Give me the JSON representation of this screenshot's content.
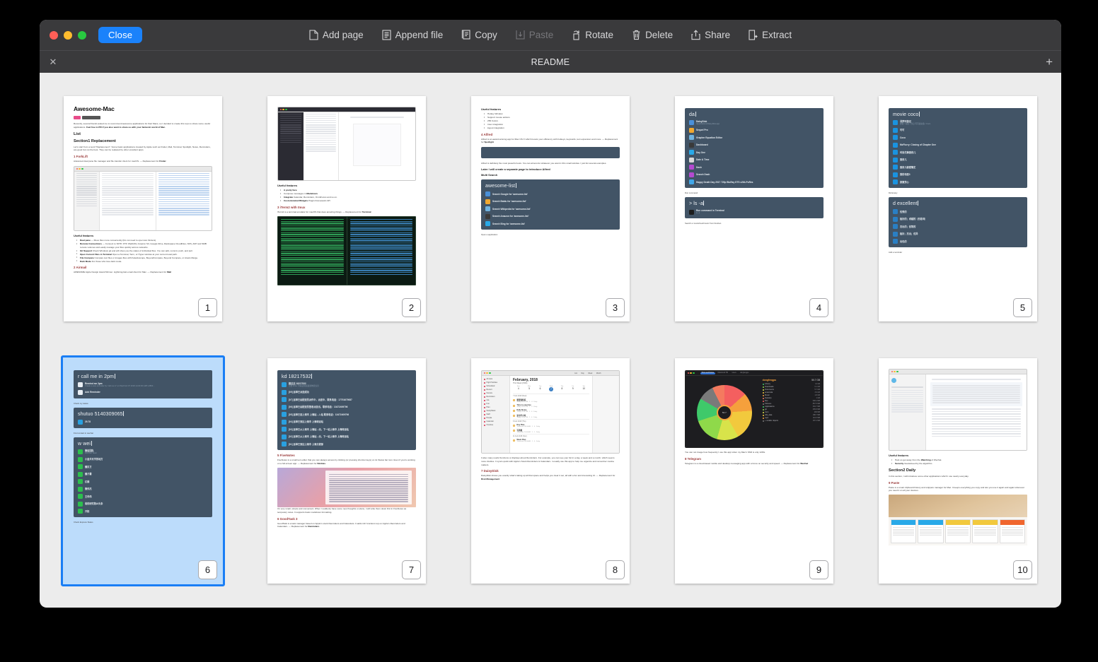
{
  "window": {
    "close_button": "Close",
    "traffic_lights": [
      "close-red",
      "minimize-yellow",
      "zoom-green"
    ]
  },
  "toolbar": {
    "items": [
      {
        "label": "Add page",
        "icon": "add-page-icon",
        "disabled": false
      },
      {
        "label": "Append file",
        "icon": "append-file-icon",
        "disabled": false
      },
      {
        "label": "Copy",
        "icon": "copy-icon",
        "disabled": false
      },
      {
        "label": "Paste",
        "icon": "paste-icon",
        "disabled": true
      },
      {
        "label": "Rotate",
        "icon": "rotate-icon",
        "disabled": false
      },
      {
        "label": "Delete",
        "icon": "delete-trash-icon",
        "disabled": false
      },
      {
        "label": "Share",
        "icon": "share-icon",
        "disabled": false
      },
      {
        "label": "Extract",
        "icon": "extract-icon",
        "disabled": false
      }
    ]
  },
  "tabbar": {
    "close_icon": "✕",
    "title": "README",
    "add_icon": "+"
  },
  "colors": {
    "accent_blue": "#1a82fb",
    "selection_border": "#1a7ef5",
    "selection_fill": "#bcdcfb",
    "toolbar_bg": "#3a3a3c",
    "canvas_bg": "#ececec",
    "alfred_panel": "#425466"
  },
  "pages": [
    {
      "number": "1",
      "selected": false,
      "title": "Awesome-Mac",
      "intro": "Recently, several friends asked me to recommend awesome applications for their Macs, so I decided to create this repo to share some useful applications. <b>Feel free to PR if you also want to share us with your fantastic world of Mac.</b>",
      "section_list": "List",
      "section": "Section1 Replacement",
      "section_desc": "Let's start from a word \"Replacement\". Some basic applications created by Apple such as Finder, Mail, Terminal, Spotlight, Notes, Reminders, are good but not the best. They can be replaced by other excellent apps.",
      "item": "1 ForkLift",
      "item_desc": "Advanced dual pane file manager and file transfer client for macOS. — Replacement for <b>Finder</b>",
      "features_label": "Useful features",
      "features": [
        "<b>Dual pane</b> — Move files more conveniently (Do not need to open two Finders)",
        "<b>Remote Connections</b> — Connect to SFTP, FTP, WebDAV, Amazon S3, Google Drive, Rackspace CloudFiles, NFS, AFP and SMB remote volumes and easily manage your files quickly across networks.",
        "<b>Git Support</b> Check Windows git and will show you the status of individual files. You can add, commit, push, and pull.",
        "<b>Open Current Files in Terminal</b> Open a Terminal, Term, or Hyper window at your current local path.",
        "<b>File Compare</b> Compare text files or images files with Kaleidoscope, BeyondCompare, Beyond Compare, or Araxis Merge.",
        "<b>Dark Mode</b> For those who love dark mode."
      ],
      "item2": "2 Airmail",
      "item2_desc": "AWESOME Apple Design Award Winner. Lightning-fast email client for Mac. — Replacement for <b>Mail</b>"
    },
    {
      "number": "2",
      "selected": false,
      "features_label": "Useful features",
      "features": [
        "<b>A pretty face</b>",
        "Compose messages in <b>Markdown</b>.",
        "<b>Integrate</b> Calendar, Reminders, OmniFocus and so on.",
        "<b>Customization/Widgets</b> Plugin Framework API"
      ],
      "item": "3 iTerm2 with tmux",
      "item_desc": "iTerm2 is a terminal emulator for macOS that does amazing things. — Replacement for <b>Terminal</b>"
    },
    {
      "number": "3",
      "selected": false,
      "features_label": "Useful features",
      "features": [
        "Hotkey Window",
        "Support mouse actions",
        "256 Colors",
        "tmux integration",
        "logout integration"
      ],
      "item": "4 Alfred",
      "item_desc": "Alfred is an award-winning app for Mac OS X which boosts your efficiency with hotkeys, keywords, text expansion and more. — Replacement for <b>Spotlight</b>",
      "note": "Alfred is definitely the most powerful tools. You can almost do whatever you want in this small window. I just list several examples.",
      "note2": "Later I will create a separate page to introduce Alfred",
      "note3": "Multi Search",
      "alfred_query": "awesome-list",
      "alfred_rows": [
        "Search Google for 'awesome-list'",
        "Search Baidu for 'awesome-list'",
        "Search Wikipedia for 'awesome-list'",
        "Search Amazon for 'awesome-list'",
        "Search Bing for 'awesome-list'"
      ],
      "footer": "Open a application"
    },
    {
      "number": "4",
      "selected": false,
      "alfred_query": "da",
      "alfred_rows": [
        {
          "t1": "DaisyDisk",
          "t2": "/Applications/DaisyDisk.app"
        },
        {
          "t1": "Sequel Pro",
          "t2": ""
        },
        {
          "t1": "Grapher Equation Editor",
          "t2": ""
        },
        {
          "t1": "Dashboard",
          "t2": ""
        },
        {
          "t1": "Day One",
          "t2": ""
        },
        {
          "t1": "Date & Time",
          "t2": ""
        },
        {
          "t1": "Dash",
          "t2": ""
        },
        {
          "t1": "Search Dash",
          "t2": ""
        },
        {
          "t1": "Happy Death Day 2017 720p BluRay DTS x264-PuRes",
          "t2": ""
        }
      ],
      "caption1": "Run command",
      "alfred_query2": "ls -a",
      "alfred_rows2": [
        {
          "t1": "Run command in Terminal",
          "t2": "ls -a"
        }
      ],
      "caption2": "Search a movie/book/music from Douban"
    },
    {
      "number": "5",
      "selected": false,
      "alfred_query": "movie coco",
      "alfred_rows": [
        {
          "t1": "寻梦环游记",
          "t2": "剧情 / 动画 / 奇幻  可可夜总会 / Coco"
        },
        {
          "t1": "可可",
          "t2": ""
        },
        {
          "t1": "Coco",
          "t2": ""
        },
        {
          "t1": "McFlurry: Closing of Chapter One",
          "t2": ""
        },
        {
          "t1": "时尚先锋香奈儿",
          "t2": ""
        },
        {
          "t1": "香奈儿",
          "t2": ""
        },
        {
          "t1": "香奈儿秘密情史",
          "t2": ""
        },
        {
          "t1": "我的邻居3",
          "t2": ""
        },
        {
          "t1": "寂寞芳心",
          "t2": ""
        }
      ],
      "caption1": "Dictionary",
      "alfred_query2": "d excellent",
      "alfred_rows2": [
        {
          "t1": "优秀的",
          "t2": ""
        },
        {
          "t1": "极好的；卓越的（形容词）",
          "t2": ""
        },
        {
          "t1": "杰出的；优等的",
          "t2": ""
        },
        {
          "t1": "极好；杰出；优异",
          "t2": ""
        },
        {
          "t1": "出色的",
          "t2": ""
        }
      ],
      "caption2": "Add a reminder"
    },
    {
      "number": "6",
      "selected": true,
      "alfred_query": "r call me in 2pm",
      "alfred_rows": [
        {
          "t1": "Remind me 2pm",
          "t2": "Create a new reminder by \"call me in\" on Wed Feb 07 2018 14:00:00 GMT+0800..."
        },
        {
          "t1": "Add Reminder",
          "t2": ""
        }
      ],
      "caption1": "Check my status",
      "alfred_query2": "shutuo 5140309065",
      "alfred_rows2": [
        {
          "t1": "29.78",
          "t2": ""
        }
      ],
      "caption2": "Find contact in wechat",
      "alfred_query3": "w wei",
      "alfred_rows3": [
        {
          "t1": "微信团队",
          "t2": "WeChat Team"
        },
        {
          "t1": "小金共写字的地方",
          "t2": ""
        },
        {
          "t1": "魏东方",
          "t2": ""
        },
        {
          "t1": "魏子豪",
          "t2": ""
        },
        {
          "t1": "红娟",
          "t2": ""
        },
        {
          "t1": "微伟杰",
          "t2": ""
        },
        {
          "t1": "王伟伟",
          "t2": ""
        },
        {
          "t1": "卷的研究院AI头条",
          "t2": ""
        },
        {
          "t1": "开阳",
          "t2": ""
        }
      ],
      "caption3": "Check Express Status"
    },
    {
      "number": "7",
      "selected": false,
      "alfred_query": "kd 18217532",
      "alfred_rows": [
        {
          "t1": "韵达达 18217532",
          "t2": "点击 Enter 查看该快递最新物流信息"
        },
        {
          "t1": "[09] 运单已派送成功",
          "t2": ""
        },
        {
          "t1": "[07] 运单已由配送员派件中，派送中，联系电话：17701670087",
          "t2": ""
        },
        {
          "t1": "[06] 运单已由配送员签收派送出，联系电话：13472409706",
          "t2": ""
        },
        {
          "t1": "[05] 运单已进上海市 上海站…入站 联系电话：13472409706",
          "t2": ""
        },
        {
          "t1": "[04] 运单已到达上海市 上海转运站",
          "t2": ""
        },
        {
          "t1": "[03] 运单已从上海市 上海站…出，下一站上海市 上海转运站",
          "t2": ""
        },
        {
          "t1": "[02] 运单已从上海市 上海站…出，下一站上海市 上海转运站",
          "t2": ""
        },
        {
          "t1": "[01] 运单已到达上海市 上海分拨部",
          "t2": ""
        }
      ],
      "item": "5 FiveNotes",
      "item_desc": "FiveNotes is a small text editor that you can always access by clicking (or pressing shortcut keys) on its Status bar icon. Even if you're working on a full-screen app. — Replacement for <b>Stickies</b>",
      "item_desc2": "It's very small, simple and convenient. When I suddenly have some new thoughts or plans, I will write them down first in FiveNotes as temporary notes. It supports basic markdown formatting.",
      "item2": "6 GoodTask 3",
      "item2_desc": "GoodTask is a task manager based on Apple's stock Reminders and Calendars. It adds rich functions top on Apple's Reminders and Calendars. — Replacement for <b>Reminders</b>"
    },
    {
      "number": "8",
      "selected": false,
      "app_title": "February, 2018",
      "app_sub": "This Week (CW6)",
      "app_days": [
        "Sun",
        "Mon",
        "Tue",
        "Wed",
        "Thu",
        "Fri",
        "Sat"
      ],
      "app_dates": [
        "4",
        "5",
        "6",
        "7",
        "8",
        "9",
        "10"
      ],
      "app_sidebar": [
        "All Lists",
        "High Priorities",
        "Scheduled",
        "Recent",
        "Snooze",
        "Reminders",
        "Life",
        "Fun",
        "Plan",
        "Study/Work",
        "Staff",
        "People",
        "Calendar",
        "Overdue"
      ],
      "app_tabs": [
        "List",
        "Day",
        "Week",
        "Month"
      ],
      "app_sections": [
        {
          "head": "7 Feb 2018 (Wed)",
          "tasks": [
            {
              "t1": "整理资料库",
              "t2": "Today 10:00 PM · 1 · 4 · Daily"
            },
            {
              "t1": "Time to exercise",
              "t2": "Today 10:00 PM · 1 · 2 · Daily"
            },
            {
              "t1": "Daily Notes",
              "t2": "Today 11:00 PM · 1 · 4 · Daily"
            },
            {
              "t1": "读书半小时",
              "t2": "Today 11:00 PM · 1 · 4 · Daily"
            }
          ]
        },
        {
          "head": "8 Feb 2018 (Thu)",
          "tasks": [
            {
              "t1": "Day Plan",
              "t2": "Tomorrow 09:00 AM · 1 · 4 · Daily"
            },
            {
              "t1": "写周报",
              "t2": "Tomorrow 11:00 AM · 1 · 1 · Daily"
            }
          ]
        },
        {
          "head": "11 Feb 2018 (Sun)",
          "tasks": [
            {
              "t1": "Week Plan",
              "t2": "Tomorrow 09:00 AM · 1 · 4 · Daily"
            }
          ]
        }
      ],
      "para": "It also many useful functions or displays about Reminders. For example, you can see your list in a day, a week and a month, which seems more intuitive. It syncs quick with Apple's Stock Reminders & Calendars. I usually use this app to help me organize and remember routine matters.",
      "item": "7 DaisyDisk",
      "item_desc": "DaisyDisk shows you exactly what's taking up all that space and helps you clear it out, all with a fun and interesting UI. — Replacement for <b>Disk Management</b>"
    },
    {
      "number": "9",
      "selected": false,
      "app_user": "dongfengpu",
      "app_total": "50.7 GB",
      "app_tabs": [
        "Show and Delete",
        "Macintosh HD",
        "Users",
        "dongfengpu"
      ],
      "app_legend": [
        {
          "name": "Library",
          "size": "12    GB"
        },
        {
          "name": "Downloads",
          "size": "6.1 GB"
        },
        {
          "name": "Documents",
          "size": "5.7 GB"
        },
        {
          "name": "anaconda",
          "size": "3.9 GB"
        },
        {
          "name": "Music",
          "size": "1.8 GB"
        },
        {
          "name": "Desktop",
          "size": "1    GB"
        },
        {
          "name": "Box",
          "size": "938.4 MB"
        },
        {
          "name": "Pictures",
          "size": "857.5 MB"
        },
        {
          "name": "Applications",
          "size": "394.7 MB"
        },
        {
          "name": "git",
          "size": "305.8 MB"
        },
        {
          "name": "Json",
          "size": "296    MB"
        },
        {
          "name": "nltk_data",
          "size": "188.7 MB"
        },
        {
          "name": "repo",
          "size": "119.0 MB"
        },
        {
          "name": "+ smaller objects",
          "size": "187.2 MB"
        }
      ],
      "app_footer": "Drag and drop files here to collect them",
      "para": "You can not image how frequently I use this app when my Mac's SSD is only 128G.",
      "item": "8 Telegram",
      "item_desc": "Telegram is a cloud-based mobile and desktop messaging app with a focus on security and speed. — Replacement for <b>Wechat</b>"
    },
    {
      "number": "10",
      "selected": false,
      "features_label": "Useful features",
      "features": [
        "Help us get away from the <b>Watching</b> of Wechat.",
        "<b>Security</b> Guaranteed by the algorithm."
      ],
      "section": "Section2 Daily",
      "section_desc": "In this section, I will introduce some other applications which I use nearly everyday.",
      "item": "9 Paste",
      "item_desc": "Paste is a smart clipboard history and snippets manager for Mac. It keeps everything you copy and lets you use it again and again whenever you need it on all your devices."
    }
  ]
}
